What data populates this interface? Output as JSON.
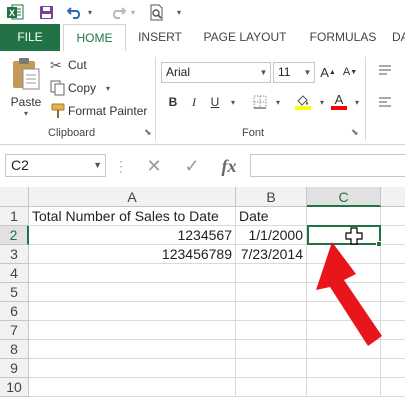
{
  "app": {
    "name": "Microsoft Excel",
    "accent": "#217346"
  },
  "qat": {
    "icons": [
      "excel-logo",
      "save-icon",
      "undo-icon",
      "redo-icon",
      "print-preview-icon",
      "customize-qat-icon"
    ]
  },
  "tabs": [
    "FILE",
    "HOME",
    "INSERT",
    "PAGE LAYOUT",
    "FORMULAS",
    "DA"
  ],
  "active_tab": "HOME",
  "clipboard": {
    "paste": "Paste",
    "cut": "Cut",
    "copy": "Copy",
    "format_painter": "Format Painter",
    "label": "Clipboard"
  },
  "font": {
    "name": "Arial",
    "size": "11",
    "label": "Font",
    "bold": "B",
    "italic": "I",
    "underline": "U",
    "font_color": "#ff0000",
    "fill_color": "#ffff00"
  },
  "formula_bar": {
    "name_box": "C2",
    "fx": "fx",
    "value": ""
  },
  "grid": {
    "columns": [
      "A",
      "B",
      "C"
    ],
    "active_column": "C",
    "row_numbers": [
      "1",
      "2",
      "3",
      "4",
      "5",
      "6",
      "7",
      "8",
      "9",
      "10"
    ],
    "active_row": "2",
    "rows": [
      [
        "Total Number of Sales to Date",
        "Date",
        ""
      ],
      [
        "1234567",
        "1/1/2000",
        ""
      ],
      [
        "123456789",
        "7/23/2014",
        ""
      ]
    ],
    "selected_cell": "C2"
  },
  "annotation": {
    "arrow_color": "#e8161b"
  }
}
